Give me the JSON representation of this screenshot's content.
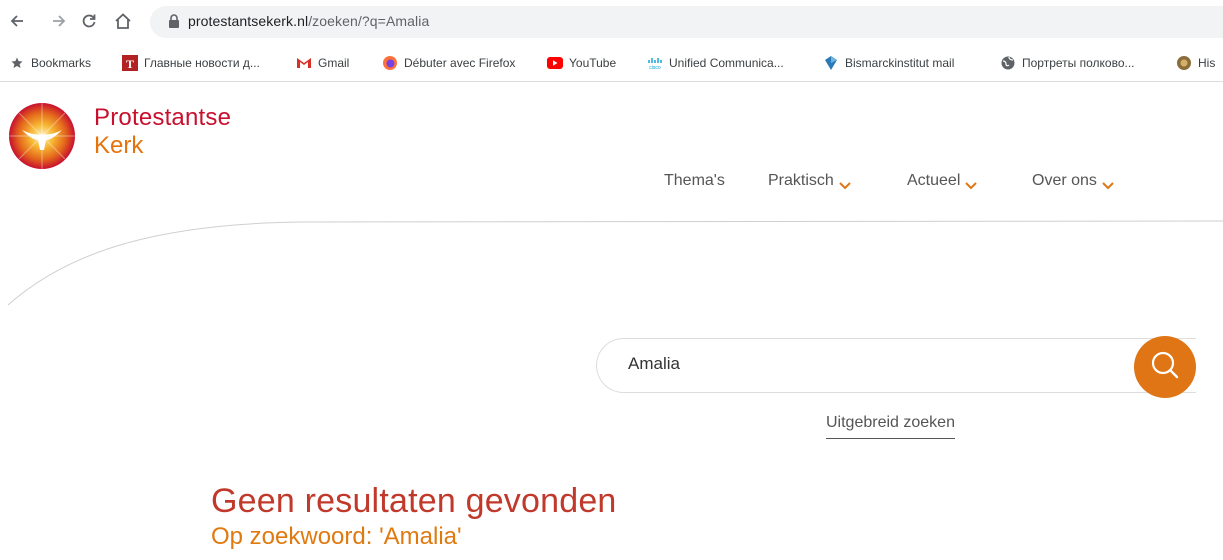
{
  "browser": {
    "url_host": "protestantsekerk.nl",
    "url_path": "/zoeken/?q=Amalia",
    "bookmarks": [
      {
        "label": "Bookmarks",
        "icon": "star-icon"
      },
      {
        "label": "Главные новости д...",
        "icon": "t-news-icon"
      },
      {
        "label": "Gmail",
        "icon": "gmail-icon"
      },
      {
        "label": "Débuter avec Firefox",
        "icon": "firefox-icon"
      },
      {
        "label": "YouTube",
        "icon": "youtube-icon"
      },
      {
        "label": "Unified Communica...",
        "icon": "cisco-icon"
      },
      {
        "label": "Bismarckinstitut mail",
        "icon": "bismarck-icon"
      },
      {
        "label": "Портреты полково...",
        "icon": "globe-icon"
      },
      {
        "label": "His",
        "icon": "history-icon"
      }
    ]
  },
  "site": {
    "brand_line1": "Protestantse",
    "brand_line2": "Kerk",
    "nav": [
      {
        "label": "Thema's",
        "has_dropdown": false
      },
      {
        "label": "Praktisch",
        "has_dropdown": true
      },
      {
        "label": "Actueel",
        "has_dropdown": true
      },
      {
        "label": "Over ons",
        "has_dropdown": true
      }
    ]
  },
  "search": {
    "value": "Amalia",
    "advanced_link": "Uitgebreid zoeken"
  },
  "results": {
    "heading": "Geen resultaten gevonden",
    "subheading": "Op zoekwoord: 'Amalia'"
  },
  "colors": {
    "brand_red": "#c8102e",
    "brand_orange": "#e5730c",
    "search_button": "#e07515"
  }
}
